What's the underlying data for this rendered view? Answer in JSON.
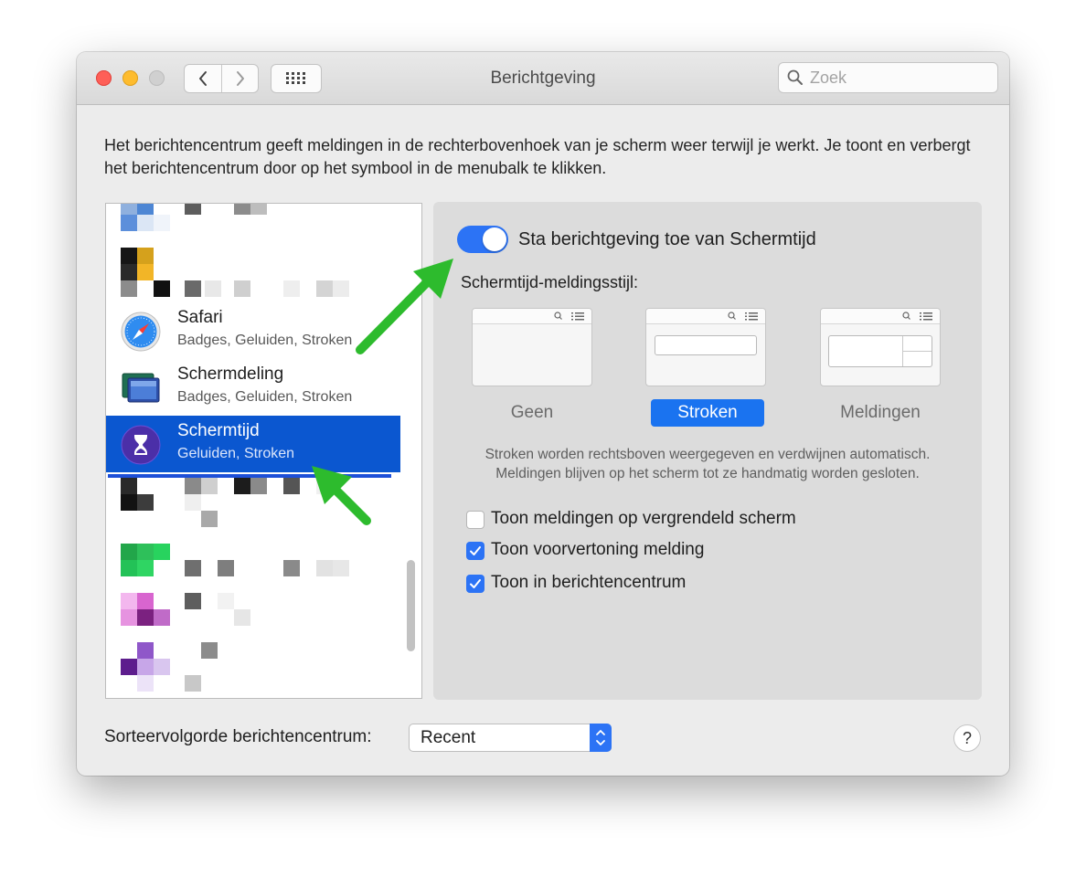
{
  "window": {
    "title": "Berichtgeving"
  },
  "search": {
    "placeholder": "Zoek"
  },
  "description": "Het berichtencentrum geeft meldingen in de rechterbovenhoek van je scherm weer terwijl je werkt. Je toont en verbergt het berichtencentrum door op het symbool in de menubalk te klikken.",
  "app_list": {
    "items": [
      {
        "name": "Safari",
        "subtitle": "Badges, Geluiden, Stroken",
        "icon": "safari-compass-icon",
        "selected": false
      },
      {
        "name": "Schermdeling",
        "subtitle": "Badges, Geluiden, Stroken",
        "icon": "screen-sharing-icon",
        "selected": false
      },
      {
        "name": "Schermtijd",
        "subtitle": "Geluiden, Stroken",
        "icon": "hourglass-icon",
        "selected": true
      }
    ]
  },
  "detail": {
    "allow_toggle_label": "Sta berichtgeving toe van Schermtijd",
    "allow_toggle_on": true,
    "style_label": "Schermtijd-meldingsstijl:",
    "styles": [
      {
        "label": "Geen",
        "selected": false
      },
      {
        "label": "Stroken",
        "selected": true
      },
      {
        "label": "Meldingen",
        "selected": false
      }
    ],
    "help_text": "Stroken worden rechtsboven weergegeven en verdwijnen automatisch. Meldingen blijven op het scherm tot ze handmatig worden gesloten.",
    "checkboxes": [
      {
        "label": "Toon meldingen op vergrendeld scherm",
        "checked": false
      },
      {
        "label": "Toon voorvertoning melding",
        "checked": true
      },
      {
        "label": "Toon in berichtencentrum",
        "checked": true
      }
    ]
  },
  "footer": {
    "sort_label": "Sorteervolgorde berichtencentrum:",
    "sort_value": "Recent",
    "help_label": "?"
  },
  "colors": {
    "accent": "#2c73f5",
    "selection": "#0b57d0",
    "annotation_arrow": "#2dbb2d"
  }
}
